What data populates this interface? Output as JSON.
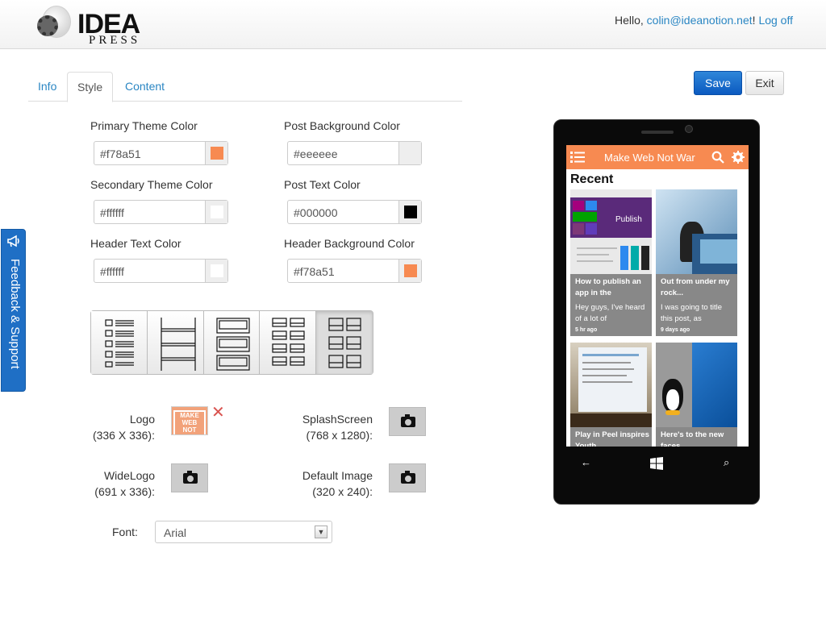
{
  "header": {
    "logo_word": "IDEA",
    "logo_sub": "PRESS",
    "greeting": "Hello, ",
    "user_email": "colin@ideanotion.net",
    "exclaim": "!",
    "logout": "Log off"
  },
  "tabs": [
    {
      "label": "Info",
      "active": false
    },
    {
      "label": "Style",
      "active": true
    },
    {
      "label": "Content",
      "active": false
    }
  ],
  "actions": {
    "save": "Save",
    "exit": "Exit"
  },
  "colors": {
    "primary": {
      "label": "Primary Theme Color",
      "value": "#f78a51"
    },
    "post_bg": {
      "label": "Post Background Color",
      "value": "#eeeeee"
    },
    "secondary": {
      "label": "Secondary Theme Color",
      "value": "#ffffff"
    },
    "post_text": {
      "label": "Post Text Color",
      "value": "#000000"
    },
    "header_text": {
      "label": "Header Text Color",
      "value": "#ffffff"
    },
    "header_bg": {
      "label": "Header Background Color",
      "value": "#f78a51"
    }
  },
  "layouts": {
    "options": [
      "list",
      "stacked-rows",
      "large-cards",
      "grid-2col",
      "grid-3col"
    ],
    "selected": "grid-3col"
  },
  "images": {
    "logo": {
      "label": "Logo",
      "size": "(336 X 336):",
      "thumb_text": "MAKE WEB NOT WAR"
    },
    "splash": {
      "label": "SplashScreen",
      "size": "(768 x 1280):"
    },
    "widelogo": {
      "label": "WideLogo",
      "size": "(691 x 336):"
    },
    "default_image": {
      "label": "Default Image",
      "size": "(320 x 240):"
    }
  },
  "font": {
    "label": "Font:",
    "value": "Arial"
  },
  "feedback": {
    "label": "Feedback & Support"
  },
  "preview": {
    "app_title": "Make Web Not War",
    "section": "Recent",
    "posts": [
      {
        "title": "How to publish an app in the",
        "excerpt": "Hey guys, I've heard of a lot of",
        "date": "5 hr ago"
      },
      {
        "title": "Out from under my rock...",
        "excerpt": "I was going to title this post, as",
        "date": "9 days ago"
      },
      {
        "title": "Play in Peel inspires Youth",
        "excerpt": "",
        "date": ""
      },
      {
        "title": "Here's to the new faces",
        "excerpt": "",
        "date": ""
      }
    ],
    "tile_text": "Publish",
    "nav": {
      "back": "←",
      "search": "⌕"
    }
  }
}
